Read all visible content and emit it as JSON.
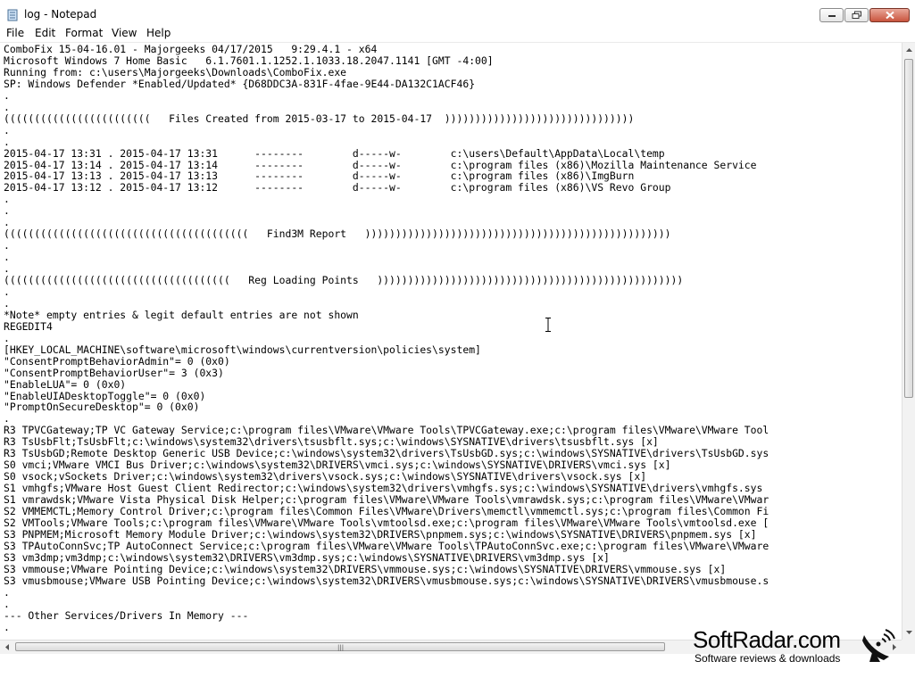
{
  "window": {
    "title": "log - Notepad"
  },
  "menu": [
    "File",
    "Edit",
    "Format",
    "View",
    "Help"
  ],
  "editor": {
    "lines": [
      "ComboFix 15-04-16.01 - Majorgeeks 04/17/2015   9:29.4.1 - x64",
      "Microsoft Windows 7 Home Basic   6.1.7601.1.1252.1.1033.18.2047.1141 [GMT -4:00]",
      "Running from: c:\\users\\Majorgeeks\\Downloads\\ComboFix.exe",
      "SP: Windows Defender *Enabled/Updated* {D68DDC3A-831F-4fae-9E44-DA132C1ACF46}",
      ".",
      ".",
      "((((((((((((((((((((((((   Files Created from 2015-03-17 to 2015-04-17  )))))))))))))))))))))))))))))))",
      ".",
      ".",
      "2015-04-17 13:31 . 2015-04-17 13:31      --------        d-----w-        c:\\users\\Default\\AppData\\Local\\temp",
      "2015-04-17 13:14 . 2015-04-17 13:14      --------        d-----w-        c:\\program files (x86)\\Mozilla Maintenance Service",
      "2015-04-17 13:13 . 2015-04-17 13:13      --------        d-----w-        c:\\program files (x86)\\ImgBurn",
      "2015-04-17 13:12 . 2015-04-17 13:12      --------        d-----w-        c:\\program files (x86)\\VS Revo Group",
      ".",
      ".",
      ".",
      "((((((((((((((((((((((((((((((((((((((((   Find3M Report   ))))))))))))))))))))))))))))))))))))))))))))))))))",
      ".",
      ".",
      ".",
      "(((((((((((((((((((((((((((((((((((((   Reg Loading Points   ))))))))))))))))))))))))))))))))))))))))))))))))))",
      ".",
      ".",
      "*Note* empty entries & legit default entries are not shown",
      "REGEDIT4",
      ".",
      "[HKEY_LOCAL_MACHINE\\software\\microsoft\\windows\\currentversion\\policies\\system]",
      "\"ConsentPromptBehaviorAdmin\"= 0 (0x0)",
      "\"ConsentPromptBehaviorUser\"= 3 (0x3)",
      "\"EnableLUA\"= 0 (0x0)",
      "\"EnableUIADesktopToggle\"= 0 (0x0)",
      "\"PromptOnSecureDesktop\"= 0 (0x0)",
      ".",
      "R3 TPVCGateway;TP VC Gateway Service;c:\\program files\\VMware\\VMware Tools\\TPVCGateway.exe;c:\\program files\\VMware\\VMware Tool",
      "R3 TsUsbFlt;TsUsbFlt;c:\\windows\\system32\\drivers\\tsusbflt.sys;c:\\windows\\SYSNATIVE\\drivers\\tsusbflt.sys [x]",
      "R3 TsUsbGD;Remote Desktop Generic USB Device;c:\\windows\\system32\\drivers\\TsUsbGD.sys;c:\\windows\\SYSNATIVE\\drivers\\TsUsbGD.sys",
      "S0 vmci;VMware VMCI Bus Driver;c:\\windows\\system32\\DRIVERS\\vmci.sys;c:\\windows\\SYSNATIVE\\DRIVERS\\vmci.sys [x]",
      "S0 vsock;vSockets Driver;c:\\windows\\system32\\drivers\\vsock.sys;c:\\windows\\SYSNATIVE\\drivers\\vsock.sys [x]",
      "S1 vmhgfs;VMware Host Guest Client Redirector;c:\\windows\\system32\\drivers\\vmhgfs.sys;c:\\windows\\SYSNATIVE\\drivers\\vmhgfs.sys",
      "S1 vmrawdsk;VMware Vista Physical Disk Helper;c:\\program files\\VMware\\VMware Tools\\vmrawdsk.sys;c:\\program files\\VMware\\VMwar",
      "S2 VMMEMCTL;Memory Control Driver;c:\\program files\\Common Files\\VMware\\Drivers\\memctl\\vmmemctl.sys;c:\\program files\\Common Fi",
      "S2 VMTools;VMware Tools;c:\\program files\\VMware\\VMware Tools\\vmtoolsd.exe;c:\\program files\\VMware\\VMware Tools\\vmtoolsd.exe [",
      "S3 PNPMEM;Microsoft Memory Module Driver;c:\\windows\\system32\\DRIVERS\\pnpmem.sys;c:\\windows\\SYSNATIVE\\DRIVERS\\pnpmem.sys [x]",
      "S3 TPAutoConnSvc;TP AutoConnect Service;c:\\program files\\VMware\\VMware Tools\\TPAutoConnSvc.exe;c:\\program files\\VMware\\VMware",
      "S3 vm3dmp;vm3dmp;c:\\windows\\system32\\DRIVERS\\vm3dmp.sys;c:\\windows\\SYSNATIVE\\DRIVERS\\vm3dmp.sys [x]",
      "S3 vmmouse;VMware Pointing Device;c:\\windows\\system32\\DRIVERS\\vmmouse.sys;c:\\windows\\SYSNATIVE\\DRIVERS\\vmmouse.sys [x]",
      "S3 vmusbmouse;VMware USB Pointing Device;c:\\windows\\system32\\DRIVERS\\vmusbmouse.sys;c:\\windows\\SYSNATIVE\\DRIVERS\\vmusbmouse.s",
      ".",
      ".",
      "--- Other Services/Drivers In Memory ---",
      "."
    ]
  },
  "watermark": {
    "brand": "SoftRadar.com",
    "tagline": "Software reviews & downloads"
  },
  "icons": {
    "app": "notepad-icon",
    "minimize": "minimize-icon",
    "maximize": "restore-icon",
    "close": "close-icon",
    "cursor": "text-cursor-icon"
  }
}
